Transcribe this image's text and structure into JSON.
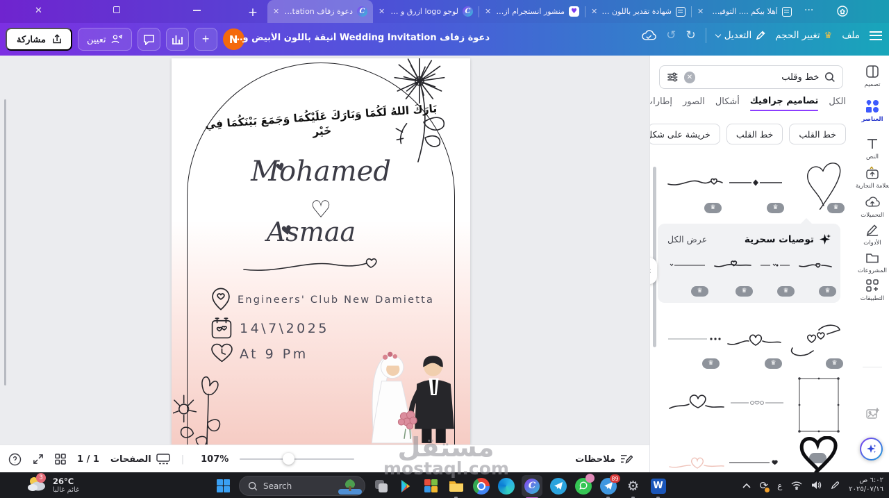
{
  "browser": {
    "tabs": [
      {
        "label": "دعوة زفاف Invitation...",
        "icon": "canva",
        "active": true
      },
      {
        "label": "لوجو logo ازرق و ورد...",
        "icon": "canva",
        "active": false
      },
      {
        "label": "منشور انستجرام ازرق ...",
        "icon": "heart",
        "active": false
      },
      {
        "label": "شهادة تقدير باللون البن...",
        "icon": "doc",
        "active": false
      },
      {
        "label": "أهلا بيكم .... التوفيق وا...",
        "icon": "doc",
        "active": false
      }
    ]
  },
  "toolbar": {
    "file": "ملف",
    "resize": "تغيير الحجم",
    "editing": "التعديل",
    "title": "دعوة زفاف Wedding Invitation أنيقة باللون الأبيض والأخضر مع الزهور",
    "share": "مشاركة",
    "assign": "تعيين",
    "avatar": "N"
  },
  "sidebar": {
    "search": {
      "value": "خط وقلب"
    },
    "tabs": [
      {
        "label": "الكل"
      },
      {
        "label": "تصاميم جرافيك",
        "active": true
      },
      {
        "label": "أشكال"
      },
      {
        "label": "الصور"
      },
      {
        "label": "إطارات"
      }
    ],
    "chips": [
      {
        "label": "خط القلب"
      },
      {
        "label": "خط القلب"
      },
      {
        "label": "خريشة على شكل قل"
      }
    ],
    "magic": {
      "title": "توصيات سحرية",
      "view_all": "عرض الكل"
    }
  },
  "rail": {
    "items": [
      {
        "label": "تصميم"
      },
      {
        "label": "العناصر",
        "active": true
      },
      {
        "label": "النص"
      },
      {
        "label": "العلامة التجارية"
      },
      {
        "label": "التحميلات"
      },
      {
        "label": "الأدوات"
      },
      {
        "label": "المشروعات"
      },
      {
        "label": "التطبيقات"
      }
    ]
  },
  "canvas": {
    "blessing": "بَارَكَ اللهُ لَكُمَا وَبَارَكَ عَلَيْكُمَا وَجَمَعَ بَيْنَكُمَا فِي خَيْر",
    "groom": "Mohamed",
    "bride": "Asmaa",
    "venue": "Engineers' Club New Damietta",
    "date": "14\\7\\2025",
    "time": "At 9 Pm"
  },
  "statusbar": {
    "pages_label": "الصفحات",
    "page_indicator": "1 / 1",
    "zoom_level": "107%",
    "notes": "ملاحظات"
  },
  "taskbar": {
    "weather": {
      "temp": "26°C",
      "condition": "غائم غالبا",
      "badge": "3"
    },
    "search_placeholder": "Search",
    "badges": {
      "messages": "89"
    },
    "tray": {
      "lang": "ع",
      "time": "٦:٠٢ ص",
      "date": "٢٠٢٥/٠٧/١٦"
    }
  },
  "watermark": {
    "line1": "مستقل",
    "line2": "mostaql.com"
  },
  "colors": {
    "accent": "#8b3dff",
    "element_blue": "#3d5afe",
    "page_pink": "#f6ccc4",
    "pro_badge": "#8e939b"
  }
}
